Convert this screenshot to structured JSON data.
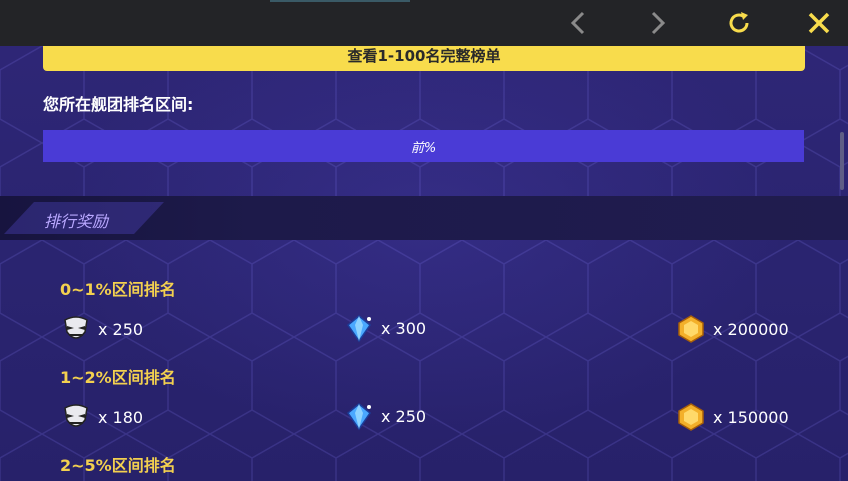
{
  "toolbar": {
    "back_icon": "chevron-left-icon",
    "forward_icon": "chevron-right-icon",
    "refresh_icon": "refresh-icon",
    "close_icon": "close-icon",
    "accent_color": "#f8dc4c"
  },
  "main": {
    "view_full_button": "查看1-100名完整榜单",
    "range_label": "您所在舰团排名区间:",
    "range_value": "前%",
    "section_title": "排行奖励"
  },
  "tiers": [
    {
      "label": "0~1%区间排名",
      "rewards": [
        {
          "icon": "mask-icon",
          "qty": "x 250"
        },
        {
          "icon": "crystal-icon",
          "qty": "x 300"
        },
        {
          "icon": "coin-icon",
          "qty": "x 200000"
        }
      ]
    },
    {
      "label": "1~2%区间排名",
      "rewards": [
        {
          "icon": "mask-icon",
          "qty": "x 180"
        },
        {
          "icon": "crystal-icon",
          "qty": "x 250"
        },
        {
          "icon": "coin-icon",
          "qty": "x 150000"
        }
      ]
    },
    {
      "label": "2~5%区间排名",
      "rewards": []
    }
  ]
}
